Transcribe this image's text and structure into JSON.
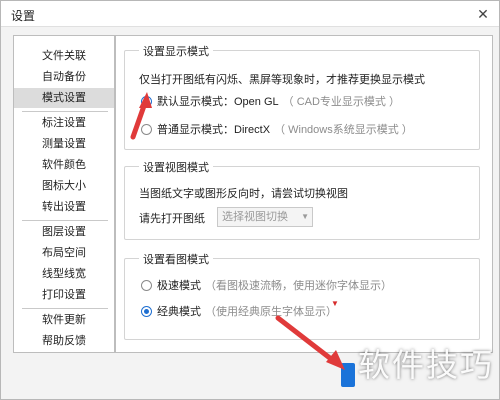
{
  "window": {
    "title": "设置",
    "close_glyph": "✕"
  },
  "sidebar": {
    "items": [
      {
        "label": "文件关联"
      },
      {
        "label": "自动备份"
      },
      {
        "label": "模式设置",
        "active": true
      },
      {
        "label": "标注设置"
      },
      {
        "label": "测量设置"
      },
      {
        "label": "软件颜色"
      },
      {
        "label": "图标大小"
      },
      {
        "label": "转出设置"
      },
      {
        "label": "图层设置"
      },
      {
        "label": "布局空间"
      },
      {
        "label": "线型线宽"
      },
      {
        "label": "打印设置"
      },
      {
        "label": "软件更新"
      },
      {
        "label": "帮助反馈"
      }
    ]
  },
  "display_mode": {
    "title": "设置显示模式",
    "description": "仅当打开图纸有闪烁、黑屏等现象时，才推荐更换显示模式",
    "options": [
      {
        "label": "默认显示模式：Open GL",
        "hint": "（ CAD专业显示模式 ）",
        "checked": true
      },
      {
        "label": "普通显示模式：DirectX",
        "hint": "（ Windows系统显示模式 ）",
        "checked": false
      }
    ]
  },
  "view_mode": {
    "title": "设置视图模式",
    "description": "当图纸文字或图形反向时，请尝试切换视图",
    "select_label": "请先打开图纸",
    "select_value": "选择视图切换",
    "select_arrow": "▼"
  },
  "reading_mode": {
    "title": "设置看图模式",
    "options": [
      {
        "label": "极速模式",
        "hint": "（看图极速流畅，使用迷你字体显示）",
        "checked": false
      },
      {
        "label": "经典模式",
        "hint": "（使用经典原生字体显示）",
        "checked": true
      }
    ],
    "marker": "▼"
  },
  "watermark": {
    "text": "软件技巧"
  },
  "colors": {
    "accent": "#1f6fd1",
    "annotation_red": "#e03a3a",
    "active_nav": "#dcdcdc"
  }
}
